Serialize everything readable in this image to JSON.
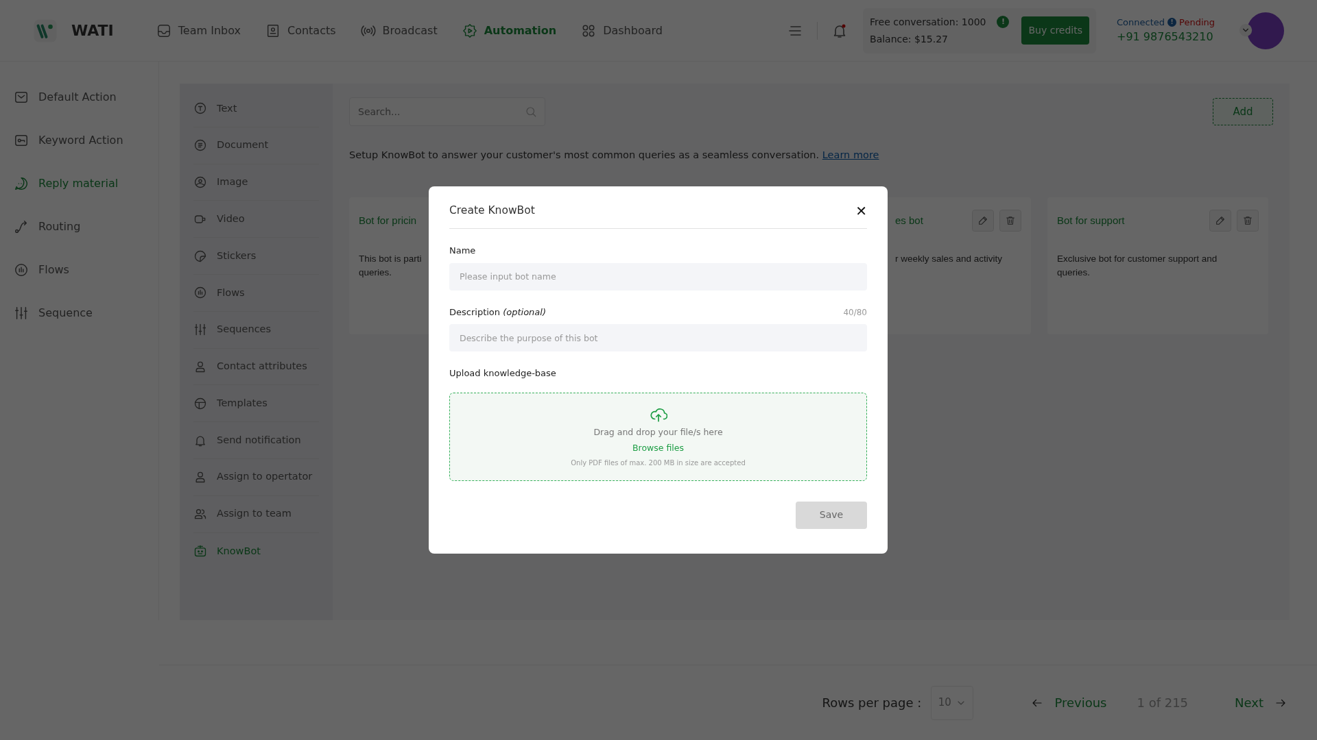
{
  "brand": {
    "name": "WATI"
  },
  "nav": [
    {
      "label": "Team Inbox",
      "selected": false
    },
    {
      "label": "Contacts",
      "selected": false
    },
    {
      "label": "Broadcast",
      "selected": false
    },
    {
      "label": "Automation",
      "selected": true
    },
    {
      "label": "Dashboard",
      "selected": false
    }
  ],
  "header": {
    "free_conversation": "Free conversation: 1000",
    "alert": "!",
    "balance": "Balance: $15.27",
    "buy_button": "Buy credits",
    "connection": "Connected",
    "status_alert": "!",
    "status": "Pending",
    "phone": "+91 9876543210"
  },
  "sidebar": {
    "items": [
      {
        "label": "Default Action",
        "selected": false
      },
      {
        "label": "Keyword Action",
        "selected": false
      },
      {
        "label": "Reply material",
        "selected": true
      },
      {
        "label": "Routing",
        "selected": false
      },
      {
        "label": "Flows",
        "selected": false
      },
      {
        "label": "Sequence",
        "selected": false
      }
    ]
  },
  "reply_types": [
    {
      "label": "Text",
      "selected": false
    },
    {
      "label": "Document",
      "selected": false
    },
    {
      "label": "Image",
      "selected": false
    },
    {
      "label": "Video",
      "selected": false
    },
    {
      "label": "Stickers",
      "selected": false
    },
    {
      "label": "Flows",
      "selected": false
    },
    {
      "label": "Sequences",
      "selected": false
    },
    {
      "label": "Contact attributes",
      "selected": false
    },
    {
      "label": "Templates",
      "selected": false
    },
    {
      "label": "Send notification",
      "selected": false
    },
    {
      "label": "Assign to opertator",
      "selected": false
    },
    {
      "label": "Assign to team",
      "selected": false
    },
    {
      "label": "KnowBot",
      "selected": true
    }
  ],
  "search": {
    "placeholder": "Search..."
  },
  "add_button": "Add",
  "intro": {
    "text": "Setup KnowBot to answer your customer's most common queries as a seamless conversation.",
    "link": "Learn more"
  },
  "cards": [
    {
      "title": "Bot for pricin",
      "lines": [
        "This bot is parti",
        "queries."
      ]
    },
    {
      "title": "es bot",
      "lines": [
        "r weekly sales and activity"
      ],
      "actions": true
    },
    {
      "title": "Bot for support",
      "lines": [
        "Exclusive bot for customer support and",
        "queries."
      ],
      "actions": true
    }
  ],
  "modal": {
    "title": "Create KnowBot",
    "close": "✕",
    "name_label": "Name",
    "name_placeholder": "Please input bot name",
    "description_label": "Description *(optional)*",
    "counter": "40/80",
    "description_placeholder": "Describe the purpose of this bot",
    "upload_label": "Upload knowledge-base",
    "dropzone": {
      "text": "Drag and drop your file/s here",
      "browse": "Browse files",
      "hint": "Only PDF files of max. 200 MB in size are accepted"
    },
    "save": {
      "label": "Save",
      "disabled": true
    }
  },
  "pagination": {
    "rows_label": "Rows per page :",
    "rows_value": "10",
    "previous": "Previous",
    "page": "1 of 215",
    "next": "Next"
  }
}
